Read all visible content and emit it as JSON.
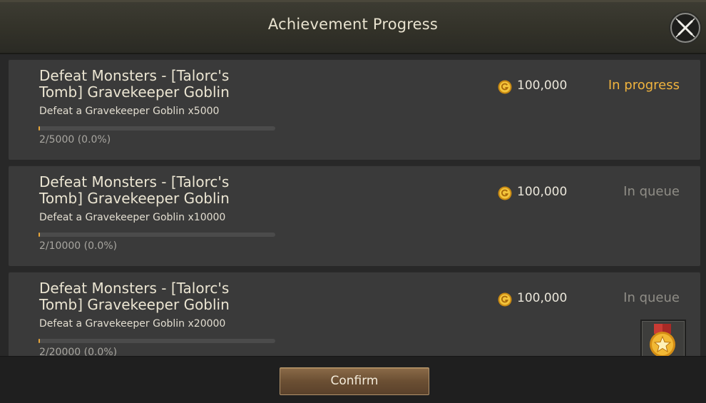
{
  "header": {
    "title": "Achievement Progress",
    "close_icon": "close-x-icon"
  },
  "achievements": [
    {
      "title": "Defeat Monsters - [Talorc's Tomb] Gravekeeper Goblin",
      "description": "Defeat a Gravekeeper Goblin x5000",
      "progress_text": "2/5000 (0.0%)",
      "progress_fraction": 0.0004,
      "reward_icon": "gold-coin-icon",
      "reward_amount": "100,000",
      "status": "In progress",
      "status_color": "#f1b43e"
    },
    {
      "title": "Defeat Monsters - [Talorc's Tomb] Gravekeeper Goblin",
      "description": "Defeat a Gravekeeper Goblin x10000",
      "progress_text": "2/10000 (0.0%)",
      "progress_fraction": 0.0002,
      "reward_icon": "gold-coin-icon",
      "reward_amount": "100,000",
      "status": "In queue",
      "status_color": "#8f8d86"
    },
    {
      "title": "Defeat Monsters - [Talorc's Tomb] Gravekeeper Goblin",
      "description": "Defeat a Gravekeeper Goblin x20000",
      "progress_text": "2/20000 (0.0%)",
      "progress_fraction": 0.0001,
      "reward_icon": "gold-coin-icon",
      "reward_amount": "100,000",
      "status": "In queue",
      "status_color": "#8f8d86",
      "badge_icon": "medal-star-icon"
    }
  ],
  "footer": {
    "confirm_label": "Confirm"
  },
  "colors": {
    "accent_gold": "#f1b43e",
    "progress_fill": "#e9a73a",
    "button_brown": "#6b4f33"
  }
}
